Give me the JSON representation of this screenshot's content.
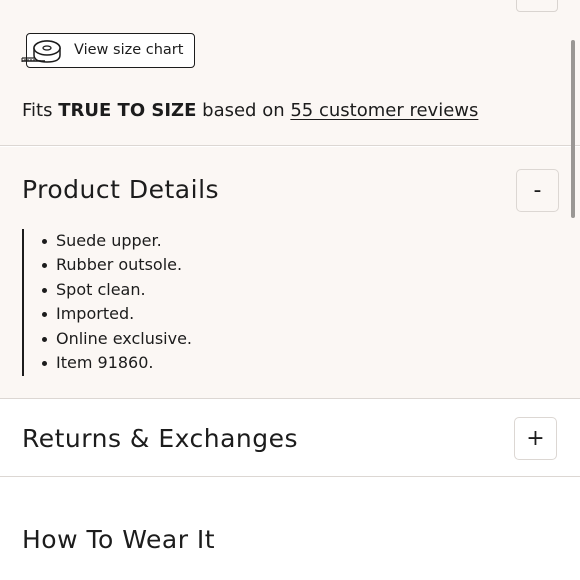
{
  "size_chart": {
    "label": "View size chart",
    "icon": "measuring-tape-icon"
  },
  "fit": {
    "prefix": "Fits",
    "rating": "TRUE TO SIZE",
    "middle": "based on",
    "reviews_link": "55 customer reviews"
  },
  "product_details": {
    "title": "Product Details",
    "toggle": "-",
    "items": [
      "Suede upper.",
      "Rubber outsole.",
      "Spot clean.",
      "Imported.",
      "Online exclusive.",
      "Item 91860."
    ]
  },
  "returns": {
    "title": "Returns & Exchanges",
    "toggle": "+"
  },
  "how_to_wear": {
    "title": "How To Wear It"
  },
  "colors": {
    "panel_bg": "#fbf7f4",
    "text": "#1c1c1c",
    "divider": "#dcd7d3"
  }
}
